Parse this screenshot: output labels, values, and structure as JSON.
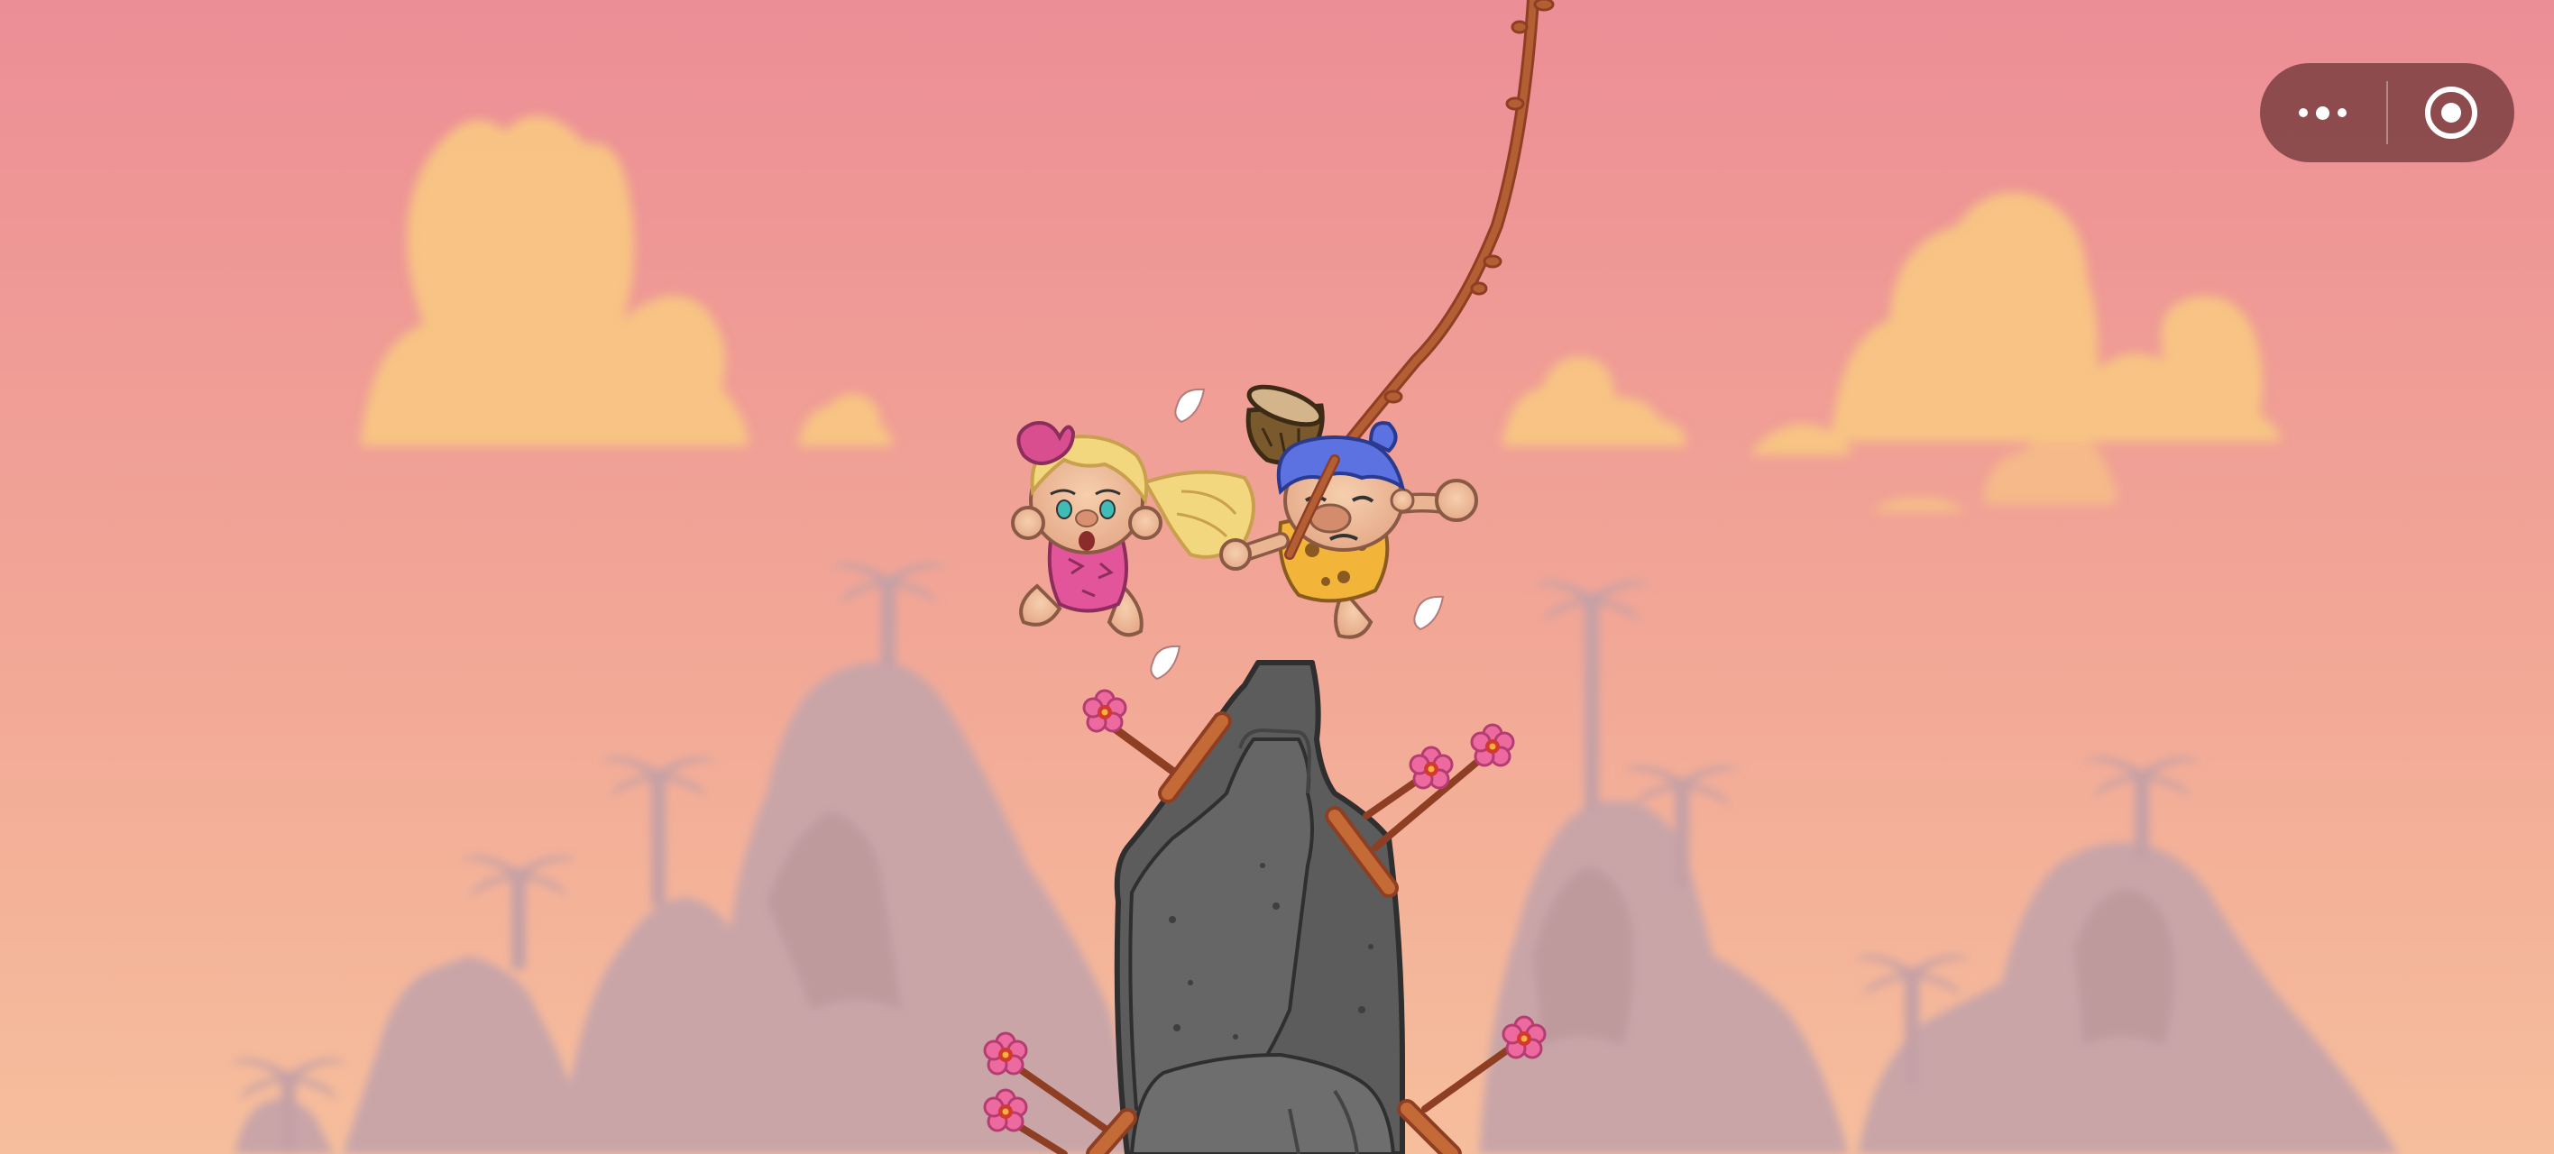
{
  "game": {
    "scene": "cliff-rope-swing",
    "characters": [
      "blonde-cavegirl",
      "blue-haired-caveman"
    ]
  },
  "capsule": {
    "more_icon": "more-dots-icon",
    "close_icon": "target-close-icon"
  },
  "colors": {
    "sky_top": "#EC8E96",
    "sky_bottom": "#F6BE9C",
    "cloud": "#F8C683",
    "mountain": "#C9A5A8",
    "rock": "#5A5A5A",
    "vine": "#B0562E",
    "flower": "#EC5A94",
    "capsule_bg": "#7A3C3E"
  }
}
